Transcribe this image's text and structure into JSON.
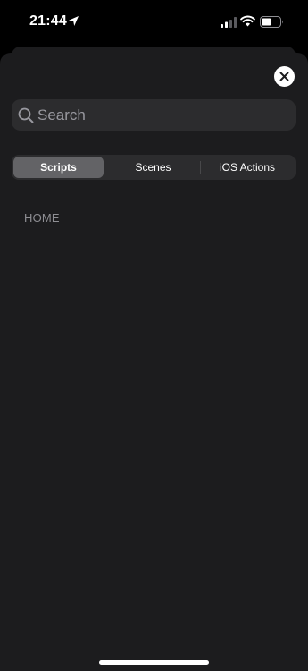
{
  "status_bar": {
    "time": "21:44",
    "icons": [
      "location-arrow-icon",
      "cellular-signal-icon",
      "wifi-icon",
      "battery-icon"
    ]
  },
  "sheet": {
    "close_icon": "close-icon",
    "search": {
      "placeholder": "Search",
      "value": "",
      "icon": "search-icon"
    },
    "segments": [
      {
        "label": "Scripts",
        "selected": true
      },
      {
        "label": "Scenes",
        "selected": false
      },
      {
        "label": "iOS Actions",
        "selected": false
      }
    ],
    "section_header": "HOME"
  },
  "colors": {
    "background": "#000000",
    "sheet": "#1c1c1e",
    "field": "#2c2c2e",
    "selected_segment": "#636366",
    "secondary_text": "#8e8e93"
  }
}
